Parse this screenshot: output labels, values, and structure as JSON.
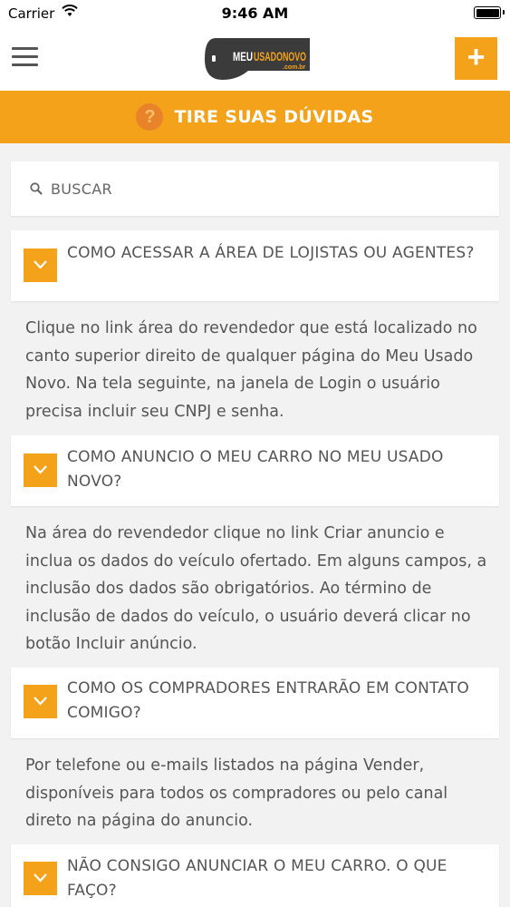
{
  "status_bar": {
    "carrier": "Carrier",
    "time": "9:46 AM"
  },
  "nav": {
    "menu_icon": "hamburger-menu-icon",
    "logo_text_meu": "MEU",
    "logo_text_usado": "USADONOVO",
    "logo_text_domain": ".com.br",
    "add_label": "+"
  },
  "header": {
    "help_icon_label": "?",
    "title": "TIRE SUAS DÚVIDAS"
  },
  "search": {
    "placeholder": "BUSCAR",
    "value": ""
  },
  "faq": [
    {
      "question": "COMO ACESSAR A ÁREA DE LOJISTAS OU AGENTES?",
      "answer": "Clique no link área do revendedor que está localizado no canto superior direito de qualquer página do Meu Usado Novo. Na tela seguinte, na janela de Login o usuário precisa incluir seu CNPJ e senha."
    },
    {
      "question": "COMO ANUNCIO O MEU CARRO NO MEU USADO NOVO?",
      "answer": "Na área do revendedor clique no link Criar anuncio e inclua os dados do veículo ofertado. Em alguns campos, a inclusão dos dados são obrigatórios. Ao término de inclusão de dados do veículo, o usuário deverá clicar no botão Incluir anúncio."
    },
    {
      "question": "COMO OS COMPRADORES ENTRARÃO EM CONTATO COMIGO?",
      "answer": "Por telefone ou e-mails listados na página Vender, disponíveis para todos os compradores ou pelo canal direto na página do anuncio."
    },
    {
      "question": "NÃO CONSIGO ANUNCIAR O MEU CARRO. O QUE FAÇO?",
      "answer": ""
    }
  ],
  "colors": {
    "accent": "#f5a21b",
    "text": "#555555",
    "background": "#f2f2f2"
  }
}
